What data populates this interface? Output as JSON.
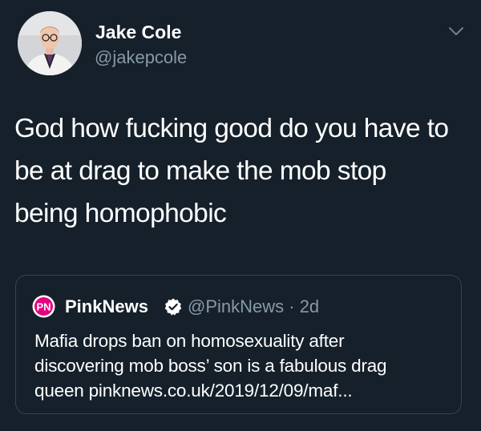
{
  "tweet": {
    "author": {
      "display_name": "Jake Cole",
      "handle": "@jakepcole",
      "avatar_icon": "profile-photo"
    },
    "menu_icon": "chevron-down-icon",
    "text_lines": [
      "God how fucking good do you have to",
      "be at drag to make the mob stop",
      "being homophobic"
    ]
  },
  "quoted_tweet": {
    "logo_icon": "pinknews-logo",
    "logo_text": "PN",
    "display_name": "PinkNews",
    "verified_icon": "verified-badge-icon",
    "handle_time": "@PinkNews · 2d",
    "text_lines": [
      "Mafia drops ban on homosexuality after",
      "discovering mob boss’ son is a fabulous drag",
      "queen pinknews.co.uk/2019/12/09/maf..."
    ]
  },
  "colors": {
    "background": "#15202b",
    "primary_text": "#ffffff",
    "secondary_text": "#8899a6",
    "card_border": "#38444d"
  }
}
